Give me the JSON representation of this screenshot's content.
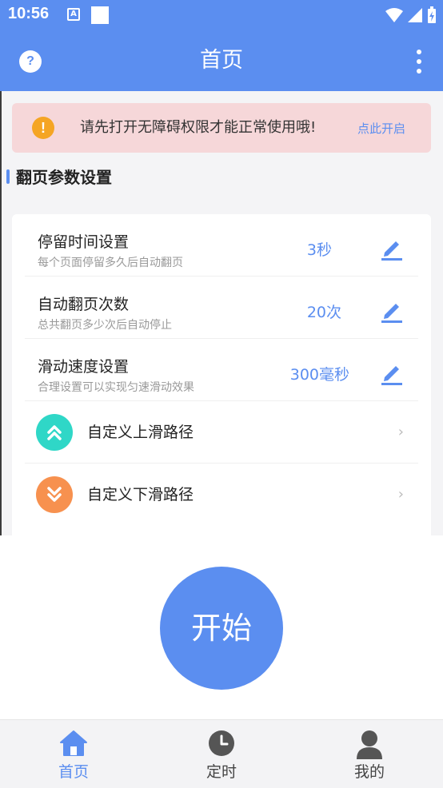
{
  "status_bar": {
    "time": "10:56",
    "a_icon": "A"
  },
  "app_bar": {
    "title": "首页",
    "help_icon": "?"
  },
  "alert": {
    "icon": "!",
    "message": "请先打开无障碍权限才能正常使用哦!",
    "action": "点此开启"
  },
  "section": {
    "title": "翻页参数设置"
  },
  "settings": [
    {
      "title": "停留时间设置",
      "subtitle": "每个页面停留多久后自动翻页",
      "value": "3秒"
    },
    {
      "title": "自动翻页次数",
      "subtitle": "总共翻页多少次后自动停止",
      "value": "20次"
    },
    {
      "title": "滑动速度设置",
      "subtitle": "合理设置可以实现匀速滑动效果",
      "value": "300毫秒"
    }
  ],
  "paths": [
    {
      "label": "自定义上滑路径",
      "icon": "double-chevron-up-icon"
    },
    {
      "label": "自定义下滑路径",
      "icon": "double-chevron-down-icon"
    }
  ],
  "start_button": {
    "label": "开始"
  },
  "bottom_nav": [
    {
      "label": "首页",
      "icon": "home-icon",
      "active": true
    },
    {
      "label": "定时",
      "icon": "clock-icon",
      "active": false
    },
    {
      "label": "我的",
      "icon": "person-icon",
      "active": false
    }
  ],
  "colors": {
    "primary": "#5b8ef0",
    "alert_bg": "#f6d7d9",
    "warning": "#f5a524",
    "teal": "#2fd7c7",
    "orange": "#f7914f"
  }
}
